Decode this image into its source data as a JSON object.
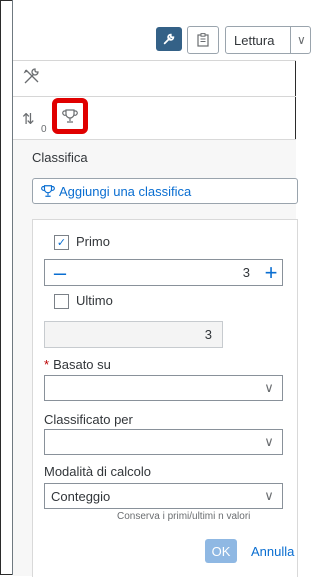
{
  "toolbar": {
    "mode_label": "Lettura",
    "wrench_icon": "wrench-icon",
    "clipboard_icon": "clipboard-icon"
  },
  "sidebar_icons": {
    "tools": "tools-icon",
    "sort": "sort-icon",
    "sort_sub": "0",
    "trophy": "trophy-icon"
  },
  "panel": {
    "title": "Classifica",
    "add_label": "Aggiungi una classifica",
    "first": {
      "label": "Primo",
      "checked": true,
      "value": "3"
    },
    "last": {
      "label": "Ultimo",
      "checked": false,
      "value": "3"
    },
    "based_on": {
      "label": "Basato su",
      "value": ""
    },
    "ranked_by": {
      "label": "Classificato per",
      "value": ""
    },
    "calc_mode": {
      "label": "Modalità di calcolo",
      "value": "Conteggio"
    },
    "hint": "Conserva i primi/ultimi n valori",
    "ok_label": "OK",
    "cancel_label": "Annulla"
  },
  "colors": {
    "accent": "#0a6ed1",
    "highlight": "#e00000",
    "toolbar_active": "#346187"
  }
}
